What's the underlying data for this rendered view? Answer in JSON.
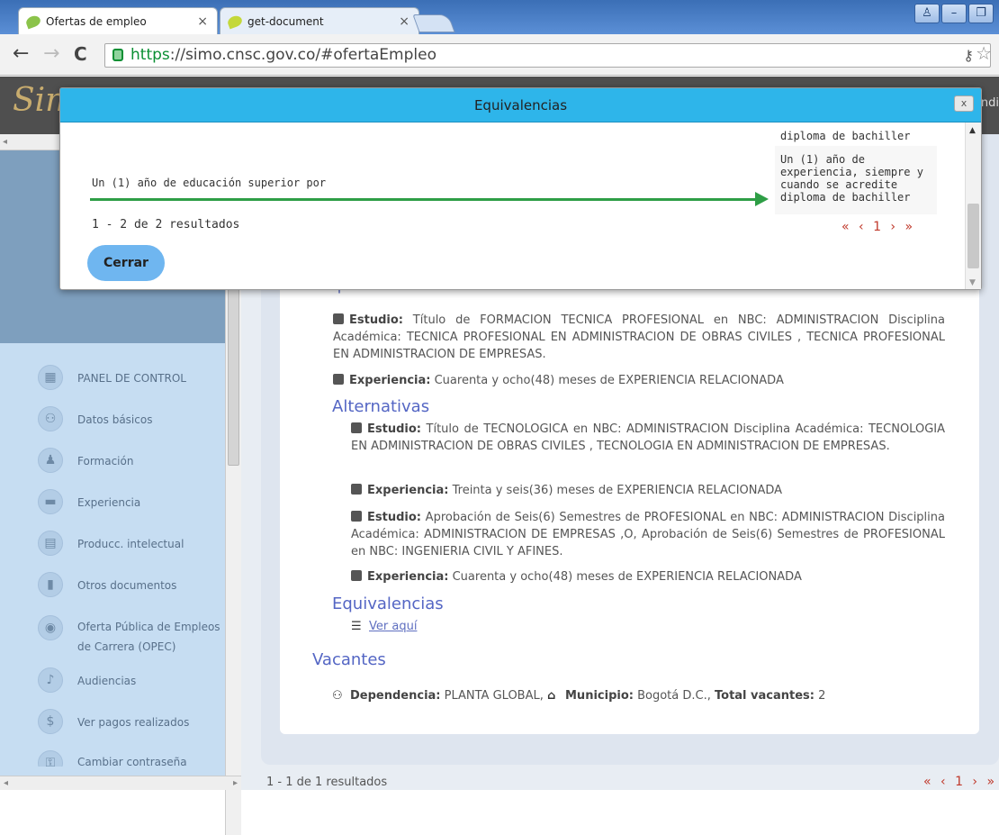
{
  "browser": {
    "tabs": [
      {
        "label": "Ofertas de empleo",
        "close": "×"
      },
      {
        "label": "get-document",
        "close": "×"
      }
    ],
    "url_protocol": "https",
    "url_rest": "://simo.cnsc.gov.co/#ofertaEmpleo"
  },
  "sidebar": {
    "items": [
      {
        "label": "PANEL DE CONTROL",
        "icon": "dashboard-icon"
      },
      {
        "label": "Datos básicos",
        "icon": "people-icon"
      },
      {
        "label": "Formación",
        "icon": "graduate-icon"
      },
      {
        "label": "Experiencia",
        "icon": "briefcase-icon"
      },
      {
        "label": "Producc. intelectual",
        "icon": "book-icon"
      },
      {
        "label": "Otros documentos",
        "icon": "document-icon"
      },
      {
        "label": "Oferta Pública de Empleos de Carrera (OPEC)",
        "icon": "globe-icon"
      },
      {
        "label": "Audiencias",
        "icon": "audience-icon"
      },
      {
        "label": "Ver pagos realizados",
        "icon": "dollar-icon"
      },
      {
        "label": "Cambiar contraseña",
        "icon": "lock-icon"
      }
    ]
  },
  "main": {
    "partial_heading": "Requisitos",
    "req_estudio_label": "Estudio:",
    "req_estudio_text": " Título de FORMACION TECNICA PROFESIONAL en NBC: ADMINISTRACION Disciplina Académica: TECNICA PROFESIONAL EN ADMINISTRACION DE OBRAS CIVILES , TECNICA PROFESIONAL EN ADMINISTRACION DE EMPRESAS.",
    "req_exp_label": "Experiencia:",
    "req_exp_text": " Cuarenta y ocho(48) meses de EXPERIENCIA RELACIONADA",
    "alternativas_title": "Alternativas",
    "alt1_estudio_label": "Estudio:",
    "alt1_estudio_text": " Título de TECNOLOGICA en NBC: ADMINISTRACION Disciplina Académica: TECNOLOGIA EN ADMINISTRACION DE OBRAS CIVILES , TECNOLOGIA EN ADMINISTRACION DE EMPRESAS.",
    "alt1_exp_label": "Experiencia:",
    "alt1_exp_text": " Treinta y seis(36) meses de EXPERIENCIA RELACIONADA",
    "alt2_estudio_label": "Estudio:",
    "alt2_estudio_text": " Aprobación de Seis(6) Semestres de PROFESIONAL en NBC: ADMINISTRACION Disciplina Académica: ADMINISTRACION DE EMPRESAS ,O, Aprobación de Seis(6) Semestres de PROFESIONAL en NBC: INGENIERIA CIVIL Y AFINES.",
    "alt2_exp_label": "Experiencia:",
    "alt2_exp_text": " Cuarenta y ocho(48) meses de EXPERIENCIA RELACIONADA",
    "equivalencias_title": "Equivalencias",
    "ver_aqui": "Ver aquí",
    "vacantes_title": "Vacantes",
    "dep_label": "Dependencia:",
    "dep_value": " PLANTA GLOBAL, ",
    "mun_label": "Municipio:",
    "mun_value": " Bogotá D.C., ",
    "total_label": "Total vacantes:",
    "total_value": " 2",
    "footer_results": "1 - 1 de 1 resultados",
    "pager": "« ‹ 1 › »"
  },
  "modal": {
    "title": "Equivalencias",
    "close": "x",
    "prev_tail": "diploma de bachiller",
    "row_label": "Un (1) año de educación superior por",
    "row_target": "Un (1) año de experiencia, siempre y cuando se acredite diploma de bachiller",
    "results": "1 - 2 de 2 resultados",
    "pager": "« ‹ 1 › »",
    "button": "Cerrar"
  },
  "colors": {
    "modal_header": "#2eb5ea",
    "arrow": "#2e9e46",
    "pager": "#c0392b",
    "heading": "#5466c4"
  }
}
